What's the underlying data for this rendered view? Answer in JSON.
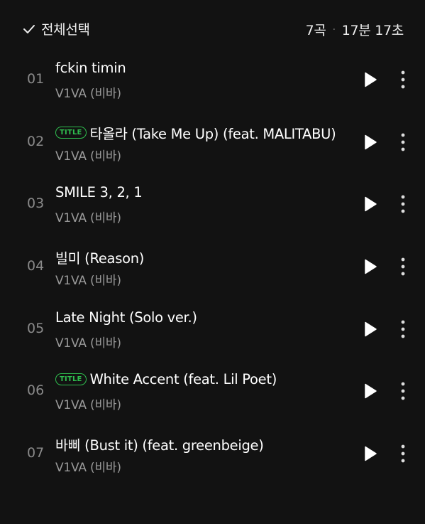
{
  "header": {
    "select_all_label": "전체선택",
    "track_count": "7곡",
    "separator": "·",
    "total_duration": "17분 17초"
  },
  "badge_label": "TITLE",
  "colors": {
    "background": "#121212",
    "accent": "#2fbd4e",
    "secondary_text": "#9a9a9a"
  },
  "tracks": [
    {
      "num": "01",
      "title": "fckin timin",
      "artist": "V1VA (비바)",
      "is_title": false
    },
    {
      "num": "02",
      "title": "타올라 (Take Me Up) (feat. MALITABU)",
      "artist": "V1VA (비바)",
      "is_title": true
    },
    {
      "num": "03",
      "title": "SMILE 3, 2, 1",
      "artist": "V1VA (비바)",
      "is_title": false
    },
    {
      "num": "04",
      "title": "빌미 (Reason)",
      "artist": "V1VA (비바)",
      "is_title": false
    },
    {
      "num": "05",
      "title": "Late Night (Solo ver.)",
      "artist": "V1VA (비바)",
      "is_title": false
    },
    {
      "num": "06",
      "title": "White Accent (feat. Lil Poet)",
      "artist": "V1VA (비바)",
      "is_title": true
    },
    {
      "num": "07",
      "title": "바삐 (Bust it) (feat. greenbeige)",
      "artist": "V1VA (비바)",
      "is_title": false
    }
  ]
}
